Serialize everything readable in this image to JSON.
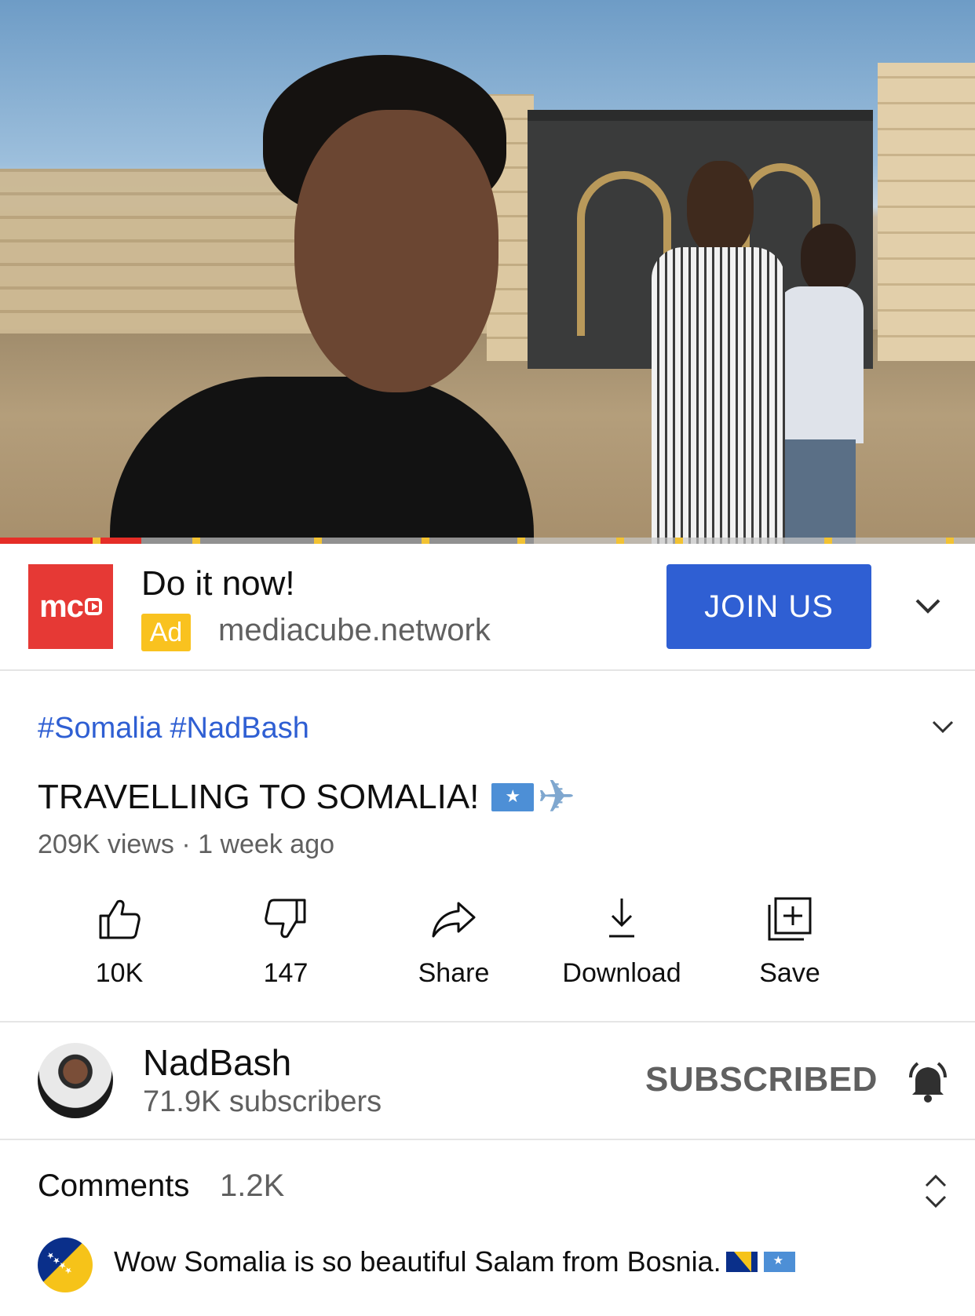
{
  "video": {
    "progress_fraction": 0.145
  },
  "ad": {
    "logo_text": "mc",
    "title": "Do it now!",
    "badge": "Ad",
    "domain": "mediacube.network",
    "cta": "JOIN US"
  },
  "info": {
    "hashtags": [
      "#Somalia",
      "#NadBash"
    ],
    "title": "TRAVELLING TO SOMALIA!",
    "views": "209K views",
    "separator": "·",
    "age": "1 week ago"
  },
  "actions": [
    {
      "icon": "thumbs-up-icon",
      "label": "10K"
    },
    {
      "icon": "thumbs-down-icon",
      "label": "147"
    },
    {
      "icon": "share-icon",
      "label": "Share"
    },
    {
      "icon": "download-icon",
      "label": "Download"
    },
    {
      "icon": "save-playlist-icon",
      "label": "Save"
    }
  ],
  "channel": {
    "name": "NadBash",
    "subscribers": "71.9K subscribers",
    "subscribe_state": "SUBSCRIBED"
  },
  "comments": {
    "heading": "Comments",
    "count": "1.2K",
    "first_comment": "Wow Somalia is so beautiful Salam from Bosnia."
  },
  "colors": {
    "accent_blue": "#2f5fd3",
    "ad_red": "#e63935",
    "ad_badge_yellow": "#f9c21f",
    "progress_red": "#e52d27",
    "secondary_text": "#606060"
  }
}
